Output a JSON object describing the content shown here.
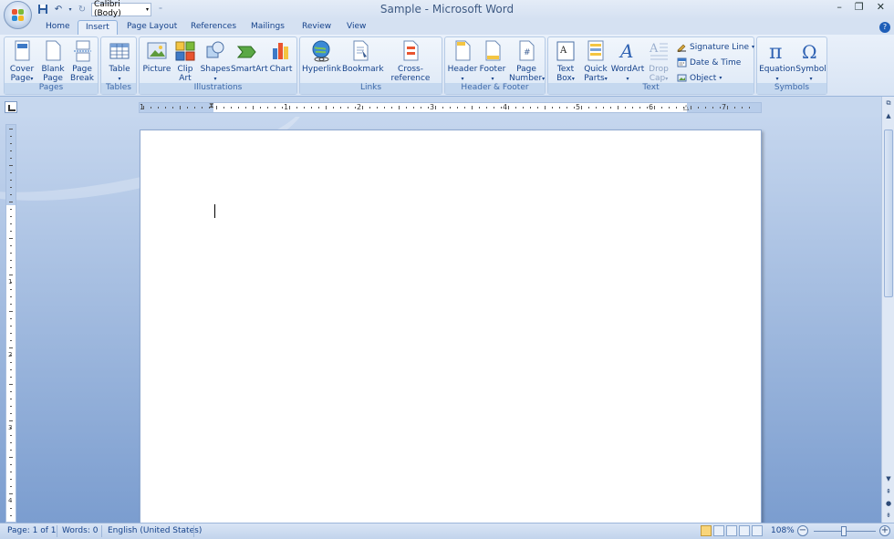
{
  "window": {
    "title": "Sample - Microsoft Word",
    "minimize": "–",
    "restore": "❐",
    "close": "✕"
  },
  "qat": {
    "font_name": "Calibri (Body)"
  },
  "tabs": [
    {
      "label": "Home"
    },
    {
      "label": "Insert"
    },
    {
      "label": "Page Layout"
    },
    {
      "label": "References"
    },
    {
      "label": "Mailings"
    },
    {
      "label": "Review"
    },
    {
      "label": "View"
    }
  ],
  "active_tab": "Insert",
  "ribbon": {
    "pages": {
      "label": "Pages",
      "cover_page": "Cover\nPage",
      "blank_page": "Blank\nPage",
      "page_break": "Page\nBreak"
    },
    "tables": {
      "label": "Tables",
      "table": "Table"
    },
    "illustrations": {
      "label": "Illustrations",
      "picture": "Picture",
      "clip_art": "Clip\nArt",
      "shapes": "Shapes",
      "smartart": "SmartArt",
      "chart": "Chart"
    },
    "links": {
      "label": "Links",
      "hyperlink": "Hyperlink",
      "bookmark": "Bookmark",
      "cross_reference": "Cross-reference"
    },
    "header_footer": {
      "label": "Header & Footer",
      "header": "Header",
      "footer": "Footer",
      "page_number": "Page\nNumber"
    },
    "text": {
      "label": "Text",
      "text_box": "Text\nBox",
      "quick_parts": "Quick\nParts",
      "wordart": "WordArt",
      "drop_cap": "Drop\nCap",
      "signature_line": "Signature Line",
      "date_time": "Date & Time",
      "object": "Object"
    },
    "symbols": {
      "label": "Symbols",
      "equation": "Equation",
      "symbol": "Symbol"
    }
  },
  "ruler": {
    "h_numbers": [
      "1",
      "1",
      "2",
      "3",
      "4",
      "5",
      "6",
      "7"
    ],
    "v_numbers": [
      "1",
      "2",
      "3",
      "4"
    ]
  },
  "statusbar": {
    "page": "Page: 1 of 1",
    "words": "Words: 0",
    "language": "English (United States)",
    "zoom": "108%",
    "zoom_minus": "−",
    "zoom_plus": "+"
  },
  "colors": {
    "accent": "#15428b",
    "workspace_top": "#c5d6ee",
    "workspace_bottom": "#7b9dcf"
  }
}
